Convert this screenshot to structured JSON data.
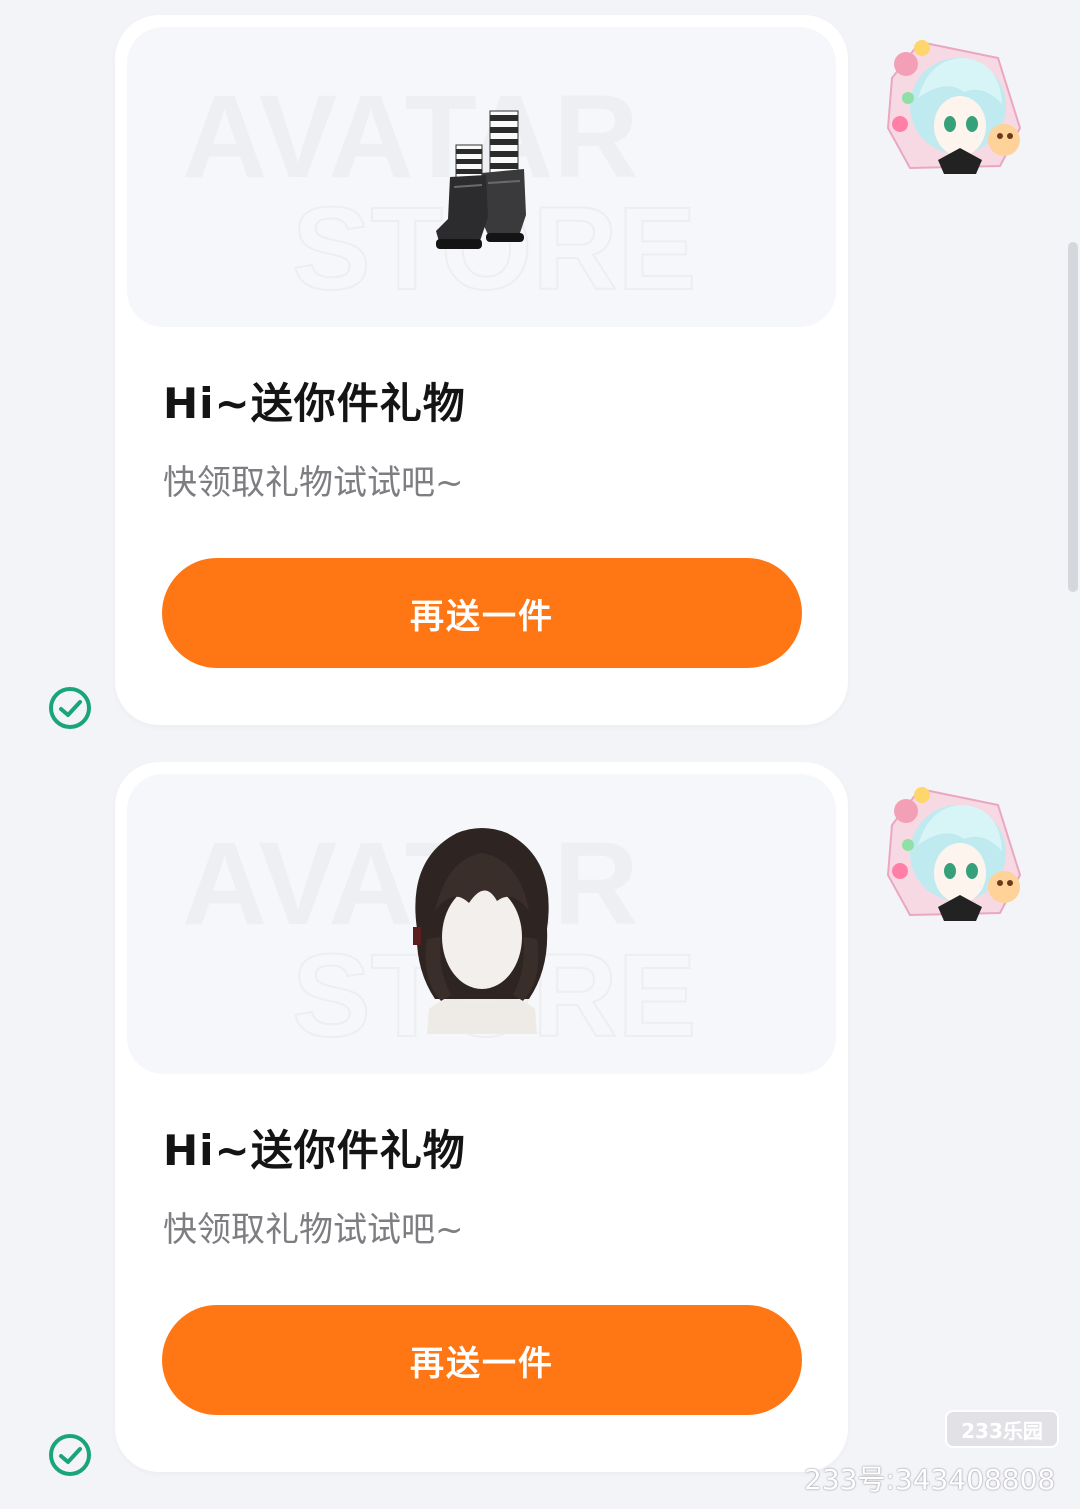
{
  "gifts": [
    {
      "title": "Hi~送你件礼物",
      "subtitle": "快领取礼物试试吧~",
      "button_label": "再送一件",
      "item_icon": "boots-icon",
      "preview_watermark": [
        "AVATAR",
        "STORE"
      ]
    },
    {
      "title": "Hi~送你件礼物",
      "subtitle": "快领取礼物试试吧~",
      "button_label": "再送一件",
      "item_icon": "hair-icon",
      "preview_watermark": [
        "AVATAR",
        "STORE"
      ]
    }
  ],
  "status_icon": "check-circle-icon",
  "sender_avatar_icon": "anime-avatar-icon",
  "watermark": {
    "logo": "233乐园",
    "id_text": "233号:343408808"
  },
  "colors": {
    "background": "#f3f4f8",
    "card": "#ffffff",
    "button": "#ff7614",
    "check": "#1aa579",
    "title": "#141414",
    "subtitle": "#7d7d82"
  }
}
